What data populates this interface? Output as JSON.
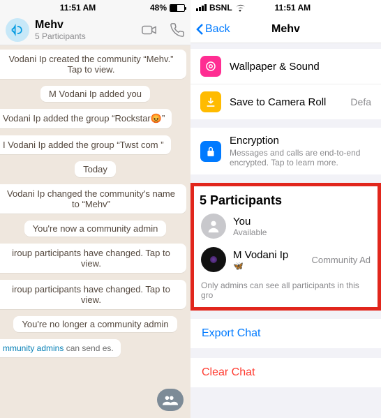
{
  "left": {
    "status": {
      "time": "11:51 AM",
      "battery": "48%"
    },
    "header": {
      "title": "Mehv",
      "subtitle": "5 Participants"
    },
    "messages": {
      "m1": "Vodani Ip created the community “Mehv.” Tap to view.",
      "m2": "M Vodani Ip added you",
      "m3": "Vodani Ip added the group “Rockstar😡”",
      "m4": "I Vodani Ip added the group “Twst com ”",
      "divider": "Today",
      "m5": "Vodani Ip changed the community's name to “Mehv”",
      "m6": "You're now a community admin",
      "m7": "iroup participants have changed. Tap to view.",
      "m8": "iroup participants have changed. Tap to view.",
      "m9": "You're no longer a community admin",
      "footer_link": "mmunity admins",
      "footer_rest": " can send es."
    }
  },
  "right": {
    "status": {
      "carrier": "BSNL",
      "time": "11:51 AM"
    },
    "back": "Back",
    "title": "Mehv",
    "rows": {
      "wallpaper": "Wallpaper & Sound",
      "camera": "Save to Camera Roll",
      "camera_right": "Defa",
      "encryption": "Encryption",
      "encryption_sub": "Messages and calls are end-to-end encrypted. Tap to learn more."
    },
    "participants": {
      "heading": "5 Participants",
      "you": "You",
      "you_sub": "Available",
      "p2": "M Vodani Ip",
      "p2_emoji": "🦋",
      "p2_right": "Community Ad",
      "note": "Only admins can see all participants in this gro"
    },
    "actions": {
      "export": "Export Chat",
      "clear": "Clear Chat"
    }
  }
}
